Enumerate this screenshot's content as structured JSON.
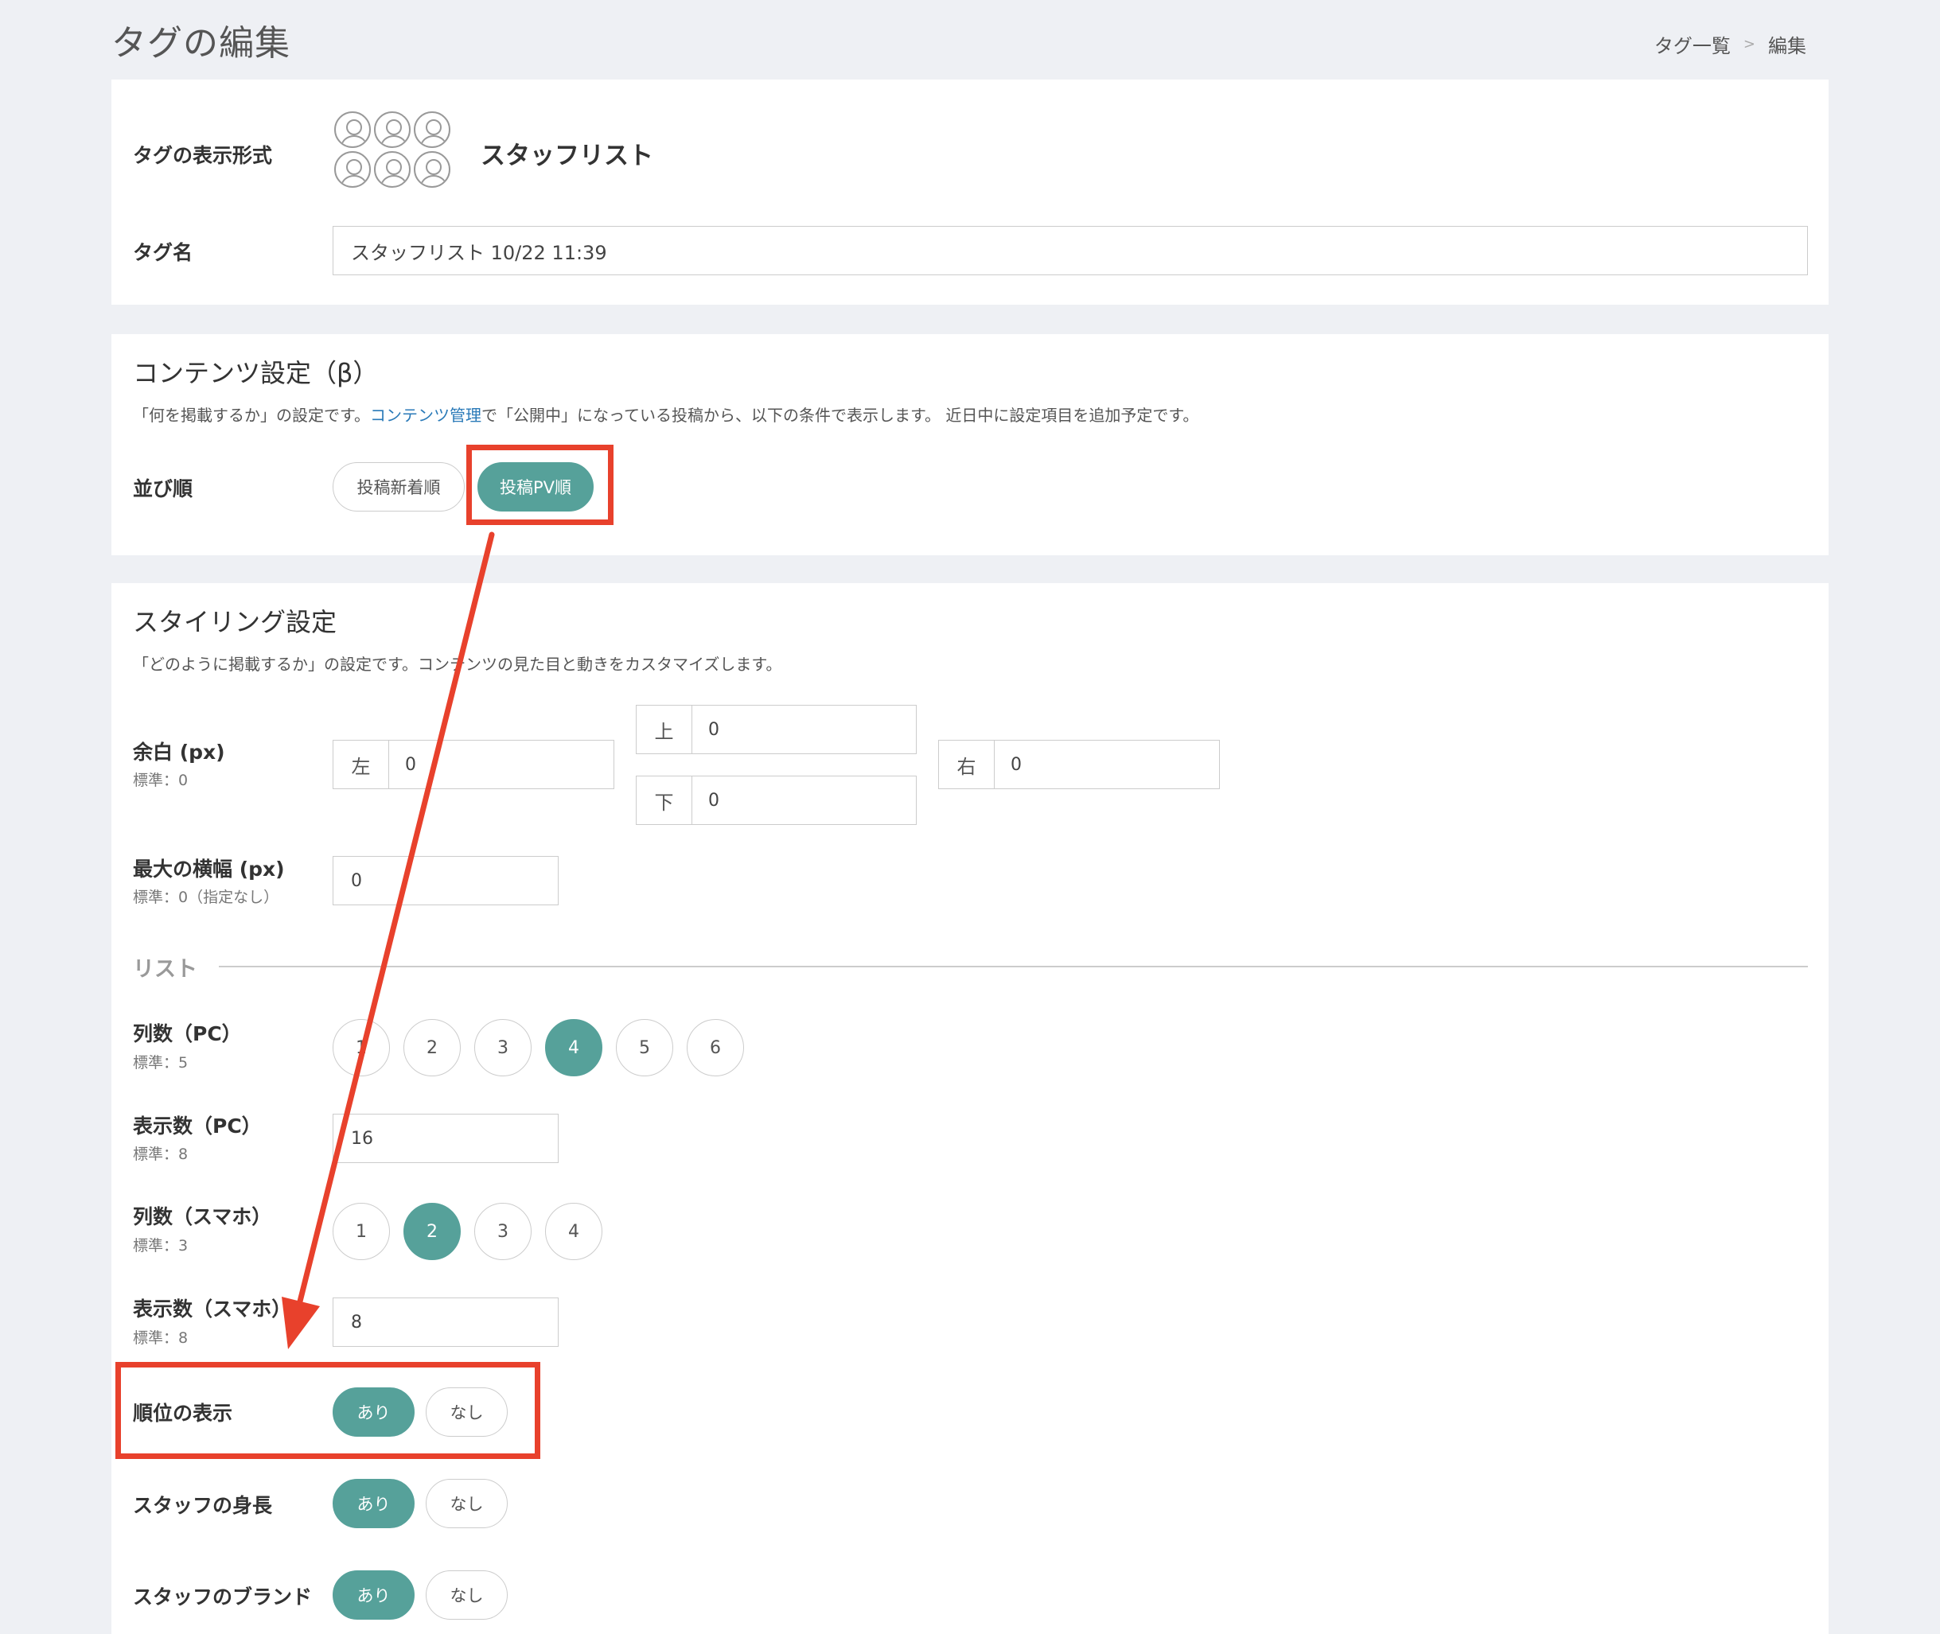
{
  "page": {
    "title": "タグの編集",
    "breadcrumb": {
      "list": "タグ一覧",
      "separator": ">",
      "current": "編集"
    }
  },
  "tag_info": {
    "format_label": "タグの表示形式",
    "format_name": "スタッフリスト",
    "format_icon": "staff-grid-icon",
    "name_label": "タグ名",
    "name_value": "スタッフリスト 10/22 11:39"
  },
  "content": {
    "title": "コンテンツ設定（β）",
    "desc_prefix": "「何を掲載するか」の設定です。",
    "desc_link": "コンテンツ管理",
    "desc_suffix": "で「公開中」になっている投稿から、以下の条件で表示します。 近日中に設定項目を追加予定です。",
    "sort_label": "並び順",
    "sort_options": [
      "投稿新着順",
      "投稿PV順"
    ],
    "sort_selected": "投稿PV順"
  },
  "styling": {
    "title": "スタイリング設定",
    "desc": "「どのように掲載するか」の設定です。コンテンツの見た目と動きをカスタマイズします。",
    "margin": {
      "label": "余白 (px)",
      "sub": "標準：0",
      "left": {
        "prefix": "左",
        "value": "0"
      },
      "top": {
        "prefix": "上",
        "value": "0"
      },
      "bottom": {
        "prefix": "下",
        "value": "0"
      },
      "right": {
        "prefix": "右",
        "value": "0"
      }
    },
    "max_width": {
      "label": "最大の横幅 (px)",
      "sub": "標準：0（指定なし）",
      "value": "0"
    },
    "list_section": "リスト",
    "cols_pc": {
      "label": "列数（PC）",
      "sub": "標準：5",
      "options": [
        "1",
        "2",
        "3",
        "4",
        "5",
        "6"
      ],
      "selected": "4"
    },
    "count_pc": {
      "label": "表示数（PC）",
      "sub": "標準：8",
      "value": "16"
    },
    "cols_sp": {
      "label": "列数（スマホ）",
      "sub": "標準：3",
      "options": [
        "1",
        "2",
        "3",
        "4"
      ],
      "selected": "2"
    },
    "count_sp": {
      "label": "表示数（スマホ）",
      "sub": "標準：8",
      "value": "8"
    },
    "rank_display": {
      "label": "順位の表示",
      "on": "あり",
      "off": "なし",
      "selected": "on"
    },
    "staff_height": {
      "label": "スタッフの身長",
      "on": "あり",
      "off": "なし",
      "selected": "on"
    },
    "staff_brand": {
      "label": "スタッフのブランド",
      "on": "あり",
      "off": "なし",
      "selected": "on"
    }
  },
  "colors": {
    "accent": "#56a19a",
    "annotation": "#e8412c",
    "link": "#2a7ab8",
    "background": "#eef0f4"
  }
}
